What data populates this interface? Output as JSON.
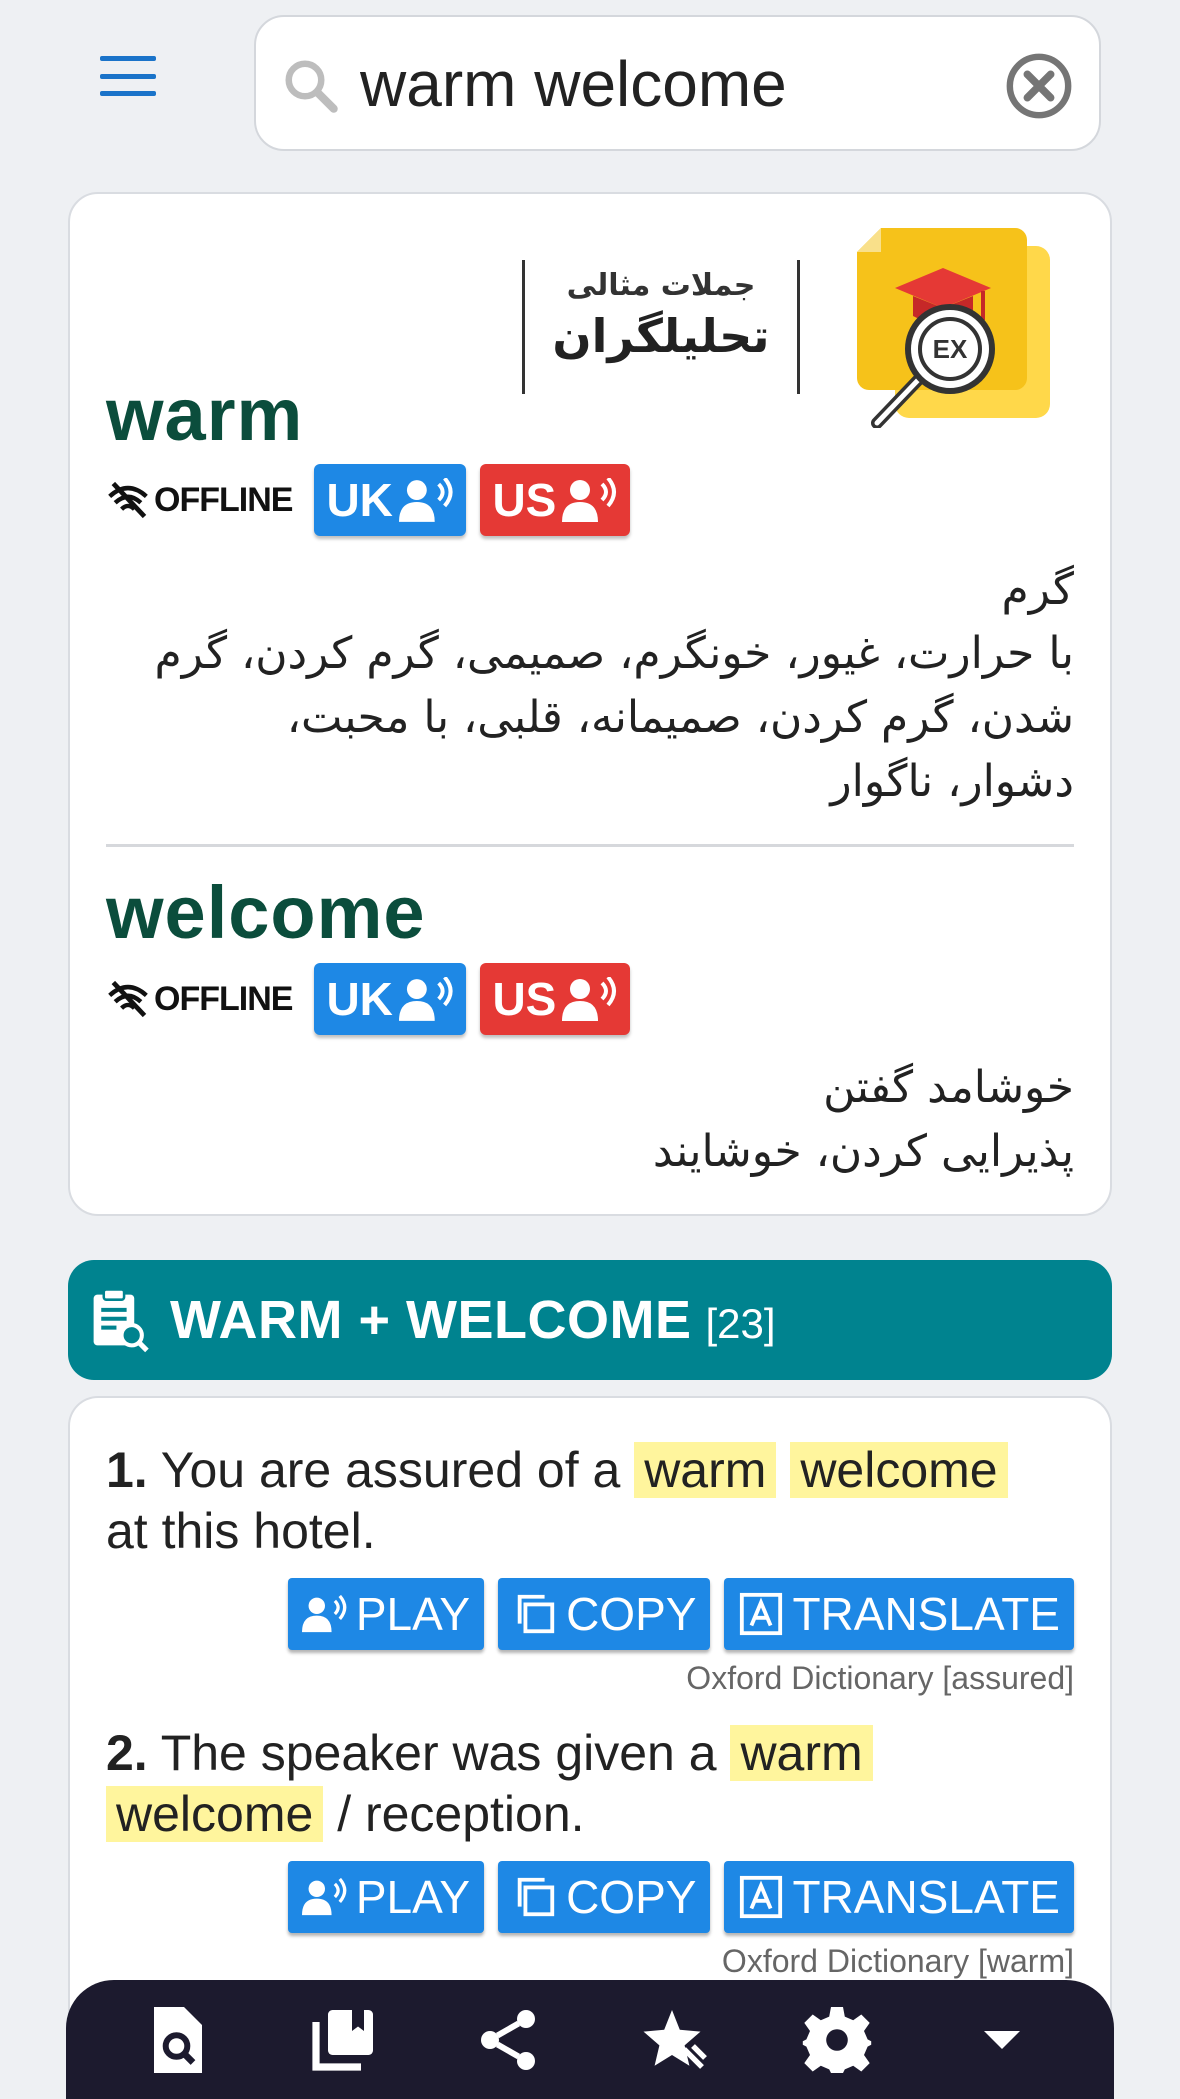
{
  "search": {
    "value": "warm welcome",
    "placeholder": ""
  },
  "logo": {
    "line1": "جملات مثالی",
    "line2": "تحلیلگران",
    "badge": "EX"
  },
  "entries": [
    {
      "word": "warm",
      "offline_label": "OFFLINE",
      "uk_label": "UK",
      "us_label": "US",
      "meanings": [
        "گرم",
        "با حرارت، غیور، خونگرم، صمیمی، گرم کردن، گرم",
        "شدن، گرم کردن، صمیمانه، قلبی، با محبت،",
        "دشوار، ناگوار"
      ]
    },
    {
      "word": "welcome",
      "offline_label": "OFFLINE",
      "uk_label": "UK",
      "us_label": "US",
      "meanings": [
        "خوشامد گفتن",
        "پذیرایی کردن، خوشایند"
      ]
    }
  ],
  "section": {
    "title": "WARM + WELCOME",
    "count": "[23]"
  },
  "examples": [
    {
      "number": "1.",
      "pre": " You are assured of a ",
      "hl1": "warm",
      "hl2": "welcome",
      "post": "at this hotel.",
      "source": "Oxford Dictionary [assured]"
    },
    {
      "number": "2.",
      "pre": " The speaker was given a ",
      "hl1": "warm",
      "hl2": "welcome",
      "post": " / reception.",
      "source": "Oxford Dictionary [warm]"
    }
  ],
  "actions": {
    "play": "PLAY",
    "copy": "COPY",
    "translate": "TRANSLATE"
  },
  "colors": {
    "accent": "#1e88e5",
    "us": "#e53935",
    "section": "#00838f",
    "word": "#0b4d3c",
    "highlight": "#fff59d",
    "nav": "#1c1a2e"
  }
}
